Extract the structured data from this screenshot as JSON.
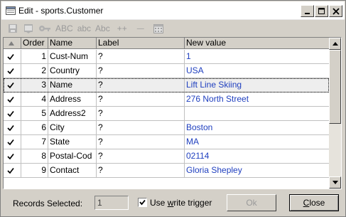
{
  "window": {
    "title": "Edit - sports.Customer"
  },
  "toolbar": {
    "items": [
      {
        "icon": "save-record-icon"
      },
      {
        "icon": "edit-record-icon"
      },
      {
        "icon": "key-icon"
      },
      {
        "label": "ABC"
      },
      {
        "label": "abc"
      },
      {
        "label": "Abc"
      },
      {
        "label": "++"
      },
      {
        "label": "—"
      },
      {
        "icon": "calendar-icon"
      }
    ]
  },
  "grid": {
    "columns": [
      "Order",
      "Name",
      "Label",
      "New value"
    ],
    "rows": [
      {
        "checked": true,
        "order": "1",
        "name": "Cust-Num",
        "label": "?",
        "value": "1"
      },
      {
        "checked": true,
        "order": "2",
        "name": "Country",
        "label": "?",
        "value": "USA"
      },
      {
        "checked": true,
        "order": "3",
        "name": "Name",
        "label": "?",
        "value": "Lift Line Skiing",
        "selected": true
      },
      {
        "checked": true,
        "order": "4",
        "name": "Address",
        "label": "?",
        "value": "276 North Street"
      },
      {
        "checked": true,
        "order": "5",
        "name": "Address2",
        "label": "?",
        "value": ""
      },
      {
        "checked": true,
        "order": "6",
        "name": "City",
        "label": "?",
        "value": "Boston"
      },
      {
        "checked": true,
        "order": "7",
        "name": "State",
        "label": "?",
        "value": "MA"
      },
      {
        "checked": true,
        "order": "8",
        "name": "Postal-Cod",
        "label": "?",
        "value": "02114"
      },
      {
        "checked": true,
        "order": "9",
        "name": "Contact",
        "label": "?",
        "value": "Gloria Shepley"
      }
    ]
  },
  "footer": {
    "records_selected_label": "Records Selected:",
    "records_selected_value": "1",
    "write_trigger_prefix": "Use ",
    "write_trigger_underlined": "w",
    "write_trigger_suffix": "rite trigger",
    "write_trigger_checked": true,
    "ok_label": "Ok",
    "close_prefix": "",
    "close_underlined": "C",
    "close_suffix": "lose"
  },
  "colors": {
    "value_text": "#1f3fbf",
    "window_face": "#d4d0c8"
  }
}
